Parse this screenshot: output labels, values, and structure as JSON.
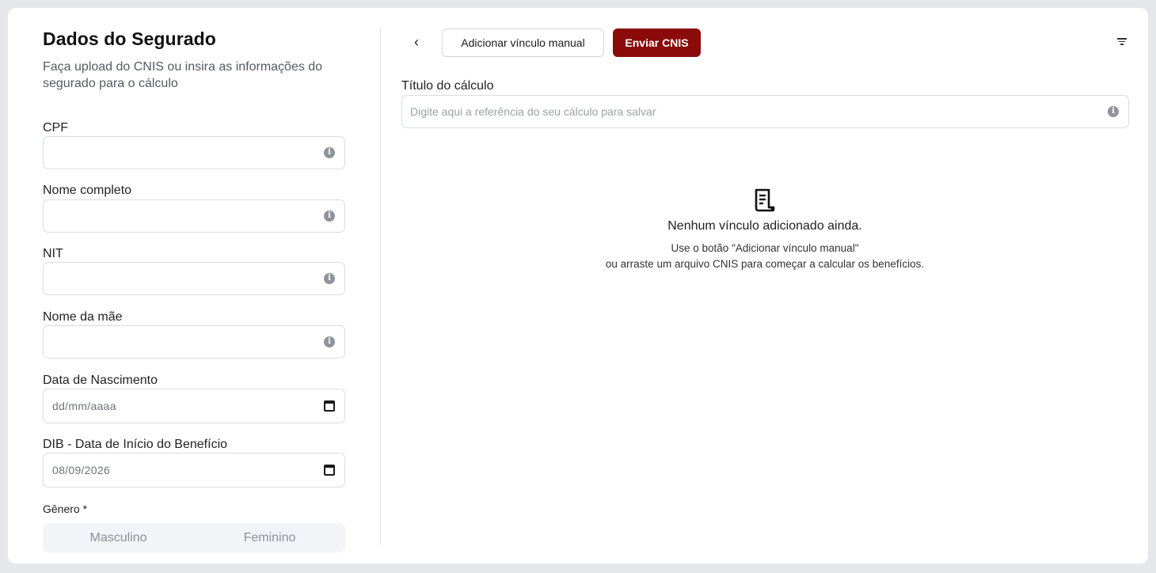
{
  "form": {
    "title": "Dados do Segurado",
    "subtitle": "Faça upload do CNIS ou insira as informações do segurado para o cálculo",
    "fields": {
      "cpf": {
        "label": "CPF",
        "value": ""
      },
      "nome_completo": {
        "label": "Nome completo",
        "value": ""
      },
      "nit": {
        "label": "NIT",
        "value": ""
      },
      "nome_mae": {
        "label": "Nome da mãe",
        "value": ""
      },
      "data_nascimento": {
        "label": "Data de Nascimento",
        "placeholder": "dd/mm/aaaa"
      },
      "dib": {
        "label": "DIB - Data de Início do Benefício",
        "value": "08/09/2026"
      }
    },
    "genero": {
      "label": "Gênero *",
      "options": [
        "Masculino",
        "Feminino"
      ]
    }
  },
  "toolbar": {
    "back_label": "‹",
    "add_manual_label": "Adicionar vínculo manual",
    "send_cnis_label": "Enviar CNIS"
  },
  "calc": {
    "label": "Título do cálculo",
    "placeholder": "Digite aqui a referência do seu cálculo para salvar"
  },
  "empty": {
    "title": "Nenhum vínculo adicionado ainda.",
    "line1": "Use o botão \"Adicionar vínculo manual\"",
    "line2": "ou arraste um arquivo CNIS para começar a calcular os benefícios."
  },
  "colors": {
    "primary": "#8b0a0a",
    "background": "#e6e7eb"
  },
  "icons": {
    "info": "info-icon",
    "calendar": "calendar-icon",
    "filter": "filter-icon",
    "document": "document-icon"
  }
}
